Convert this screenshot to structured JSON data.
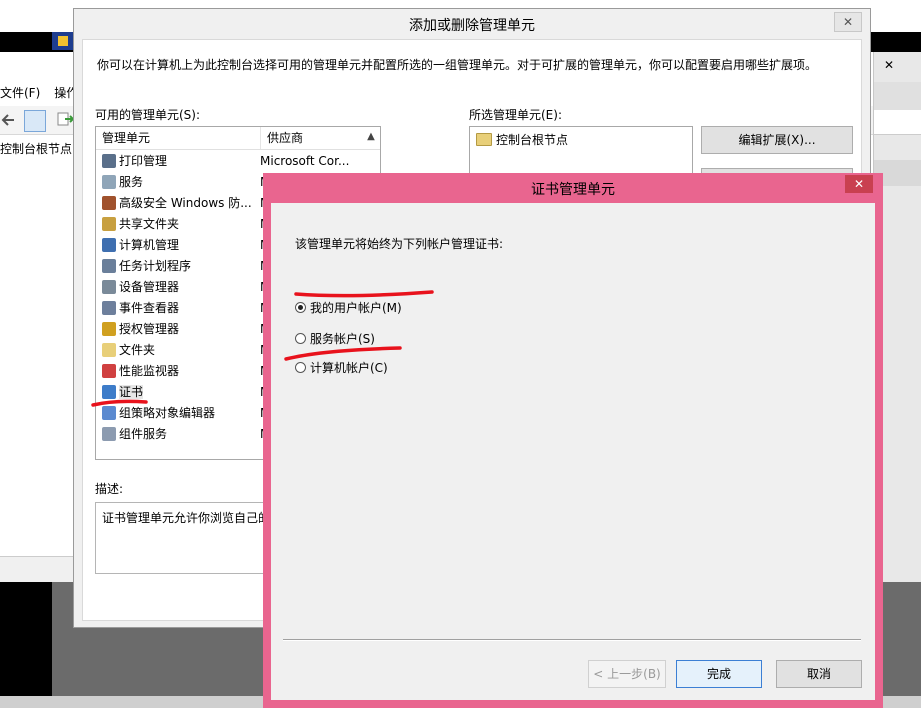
{
  "background_window": {
    "menu": [
      "文件(F)",
      "操作"
    ],
    "tree_item": "控制台根节点"
  },
  "main_dialog": {
    "title": "添加或删除管理单元",
    "close_glyph": "✕",
    "intro": "你可以在计算机上为此控制台选择可用的管理单元并配置所选的一组管理单元。对于可扩展的管理单元，你可以配置要启用哪些扩展项。",
    "available_label": "可用的管理单元(S):",
    "selected_label": "所选管理单元(E):",
    "columns": {
      "name": "管理单元",
      "vendor": "供应商"
    },
    "snapins": [
      {
        "name": "打印管理",
        "vendor": "Microsoft Cor...",
        "icon": "printer-icon",
        "color": "#5a6f8a"
      },
      {
        "name": "服务",
        "vendor": "M",
        "icon": "gears-icon",
        "color": "#8fa5b8"
      },
      {
        "name": "高级安全 Windows 防...",
        "vendor": "M",
        "icon": "firewall-icon",
        "color": "#a0522d"
      },
      {
        "name": "共享文件夹",
        "vendor": "M",
        "icon": "share-icon",
        "color": "#c8a040"
      },
      {
        "name": "计算机管理",
        "vendor": "M",
        "icon": "computer-icon",
        "color": "#3f6fb0"
      },
      {
        "name": "任务计划程序",
        "vendor": "M",
        "icon": "clock-icon",
        "color": "#6a7f9a"
      },
      {
        "name": "设备管理器",
        "vendor": "M",
        "icon": "device-icon",
        "color": "#7a8a99"
      },
      {
        "name": "事件查看器",
        "vendor": "M",
        "icon": "event-icon",
        "color": "#6d7f9c"
      },
      {
        "name": "授权管理器",
        "vendor": "M",
        "icon": "auth-icon",
        "color": "#d0a020"
      },
      {
        "name": "文件夹",
        "vendor": "M",
        "icon": "folder-icon",
        "color": "#e8cf79"
      },
      {
        "name": "性能监视器",
        "vendor": "M",
        "icon": "perf-icon",
        "color": "#d04040"
      },
      {
        "name": "证书",
        "vendor": "M",
        "icon": "certificate-icon",
        "color": "#3d7cc9"
      },
      {
        "name": "组策略对象编辑器",
        "vendor": "M",
        "icon": "policy-icon",
        "color": "#5b8ad0"
      },
      {
        "name": "组件服务",
        "vendor": "M",
        "icon": "component-icon",
        "color": "#8c9bb0"
      }
    ],
    "selected_item": "证书",
    "description_label": "描述:",
    "description": "证书管理单元允许你浏览自己的",
    "selected_snapins": [
      "控制台根节点"
    ],
    "edit_extensions_button": "编辑扩展(X)..."
  },
  "cert_dialog": {
    "title": "证书管理单元",
    "close_glyph": "✕",
    "prompt": "该管理单元将始终为下列帐户管理证书:",
    "options": [
      {
        "label": "我的用户帐户(M)",
        "checked": true
      },
      {
        "label": "服务帐户(S)",
        "checked": false
      },
      {
        "label": "计算机帐户(C)",
        "checked": false
      }
    ],
    "back_button": "< 上一步(B)",
    "finish_button": "完成",
    "cancel_button": "取消",
    "frame_color": "#e9658f",
    "annotation_color": "#e8121c"
  }
}
